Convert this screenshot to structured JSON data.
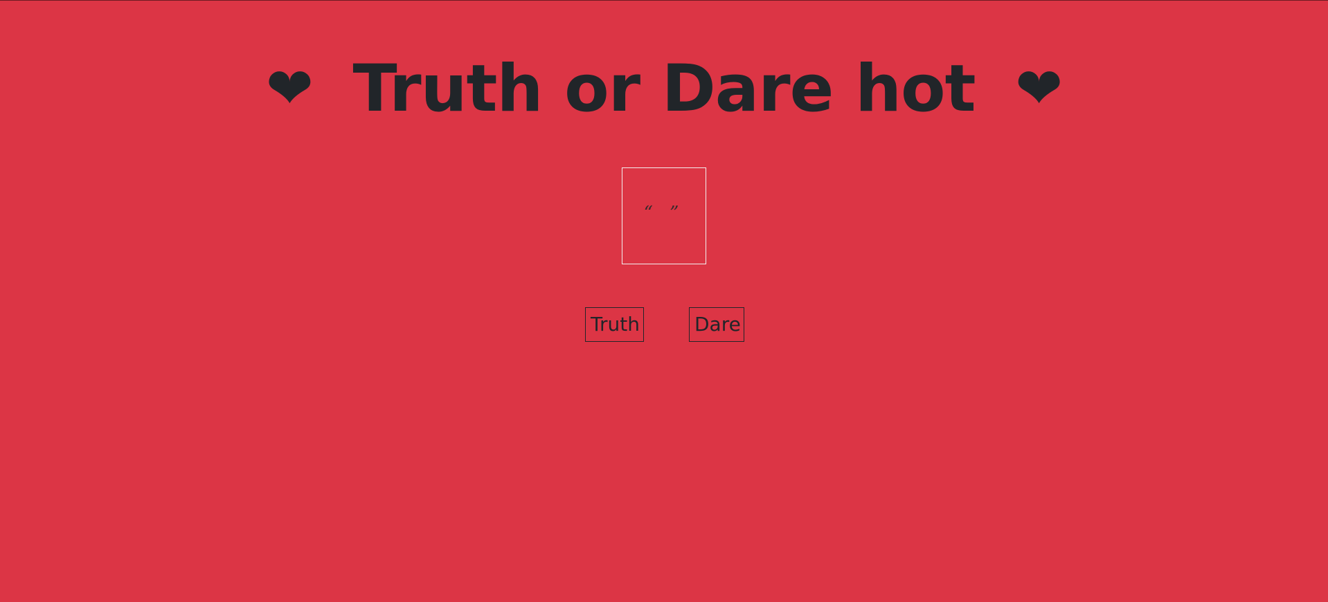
{
  "header": {
    "left_icon": "heart-icon",
    "left_glyph": "❤",
    "title": "Truth or Dare hot",
    "right_icon": "heart-icon",
    "right_glyph": "❤"
  },
  "card": {
    "quote_text": "“ ”"
  },
  "actions": {
    "truth_label": "Truth",
    "dare_label": "Dare"
  },
  "colors": {
    "background": "#dc3545",
    "text": "#212529",
    "card_border": "#f2f2f2"
  }
}
